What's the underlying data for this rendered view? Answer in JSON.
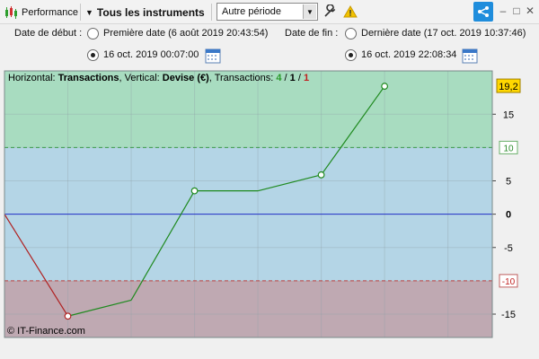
{
  "toolbar": {
    "module_label": "Performance",
    "instruments_label": "Tous les instruments",
    "period_value": "Autre période"
  },
  "dates": {
    "start_label": "Date de début :",
    "start_option_first": "Première date (6 août 2019 20:43:54)",
    "start_option_custom": "16 oct. 2019 00:07:00",
    "end_label": "Date de fin :",
    "end_option_last": "Dernière date (17 oct. 2019 10:37:46)",
    "end_option_custom": "16 oct. 2019 22:08:34"
  },
  "chart_header": {
    "horizontal_prefix": "Horizontal: ",
    "horizontal_value": "Transactions",
    "vertical_prefix": ", Vertical: ",
    "vertical_value": "Devise (€)",
    "transactions_prefix": ", Transactions: ",
    "tx_win": "4",
    "tx_sep1": " / ",
    "tx_neutral": "1",
    "tx_sep2": " / ",
    "tx_loss": "1"
  },
  "watermark": "© IT-Finance.com",
  "colors": {
    "zone_green": "#a8dcc0",
    "zone_blue": "#b4d5e6",
    "zone_red": "#bfa9b2",
    "line_up": "#1f8a1f",
    "line_down": "#b02020",
    "zero_line": "#2030c8",
    "accent": "#1f8ddc",
    "current_badge": "#ffd700"
  },
  "chart_data": {
    "type": "line",
    "x": [
      0,
      1,
      2,
      3,
      4,
      5,
      6
    ],
    "y": [
      0,
      -15.3,
      -12.9,
      3.5,
      3.5,
      5.9,
      19.2
    ],
    "markers": [
      1,
      3,
      5,
      6
    ],
    "xlim": [
      0,
      7.7
    ],
    "ylim": [
      -18.5,
      21.5
    ],
    "x_ticks": [
      "1",
      "2",
      "3",
      "4",
      "5",
      "6",
      "7"
    ],
    "y_ticks": [
      "-15",
      "-5",
      "0",
      "5",
      "15"
    ],
    "y_tick_values": [
      -15,
      -5,
      0,
      5,
      15
    ],
    "upper_threshold": "10",
    "upper_threshold_value": 10,
    "lower_threshold": "-10",
    "lower_threshold_value": -10,
    "current_value": "19,2",
    "current_value_num": 19.2
  }
}
